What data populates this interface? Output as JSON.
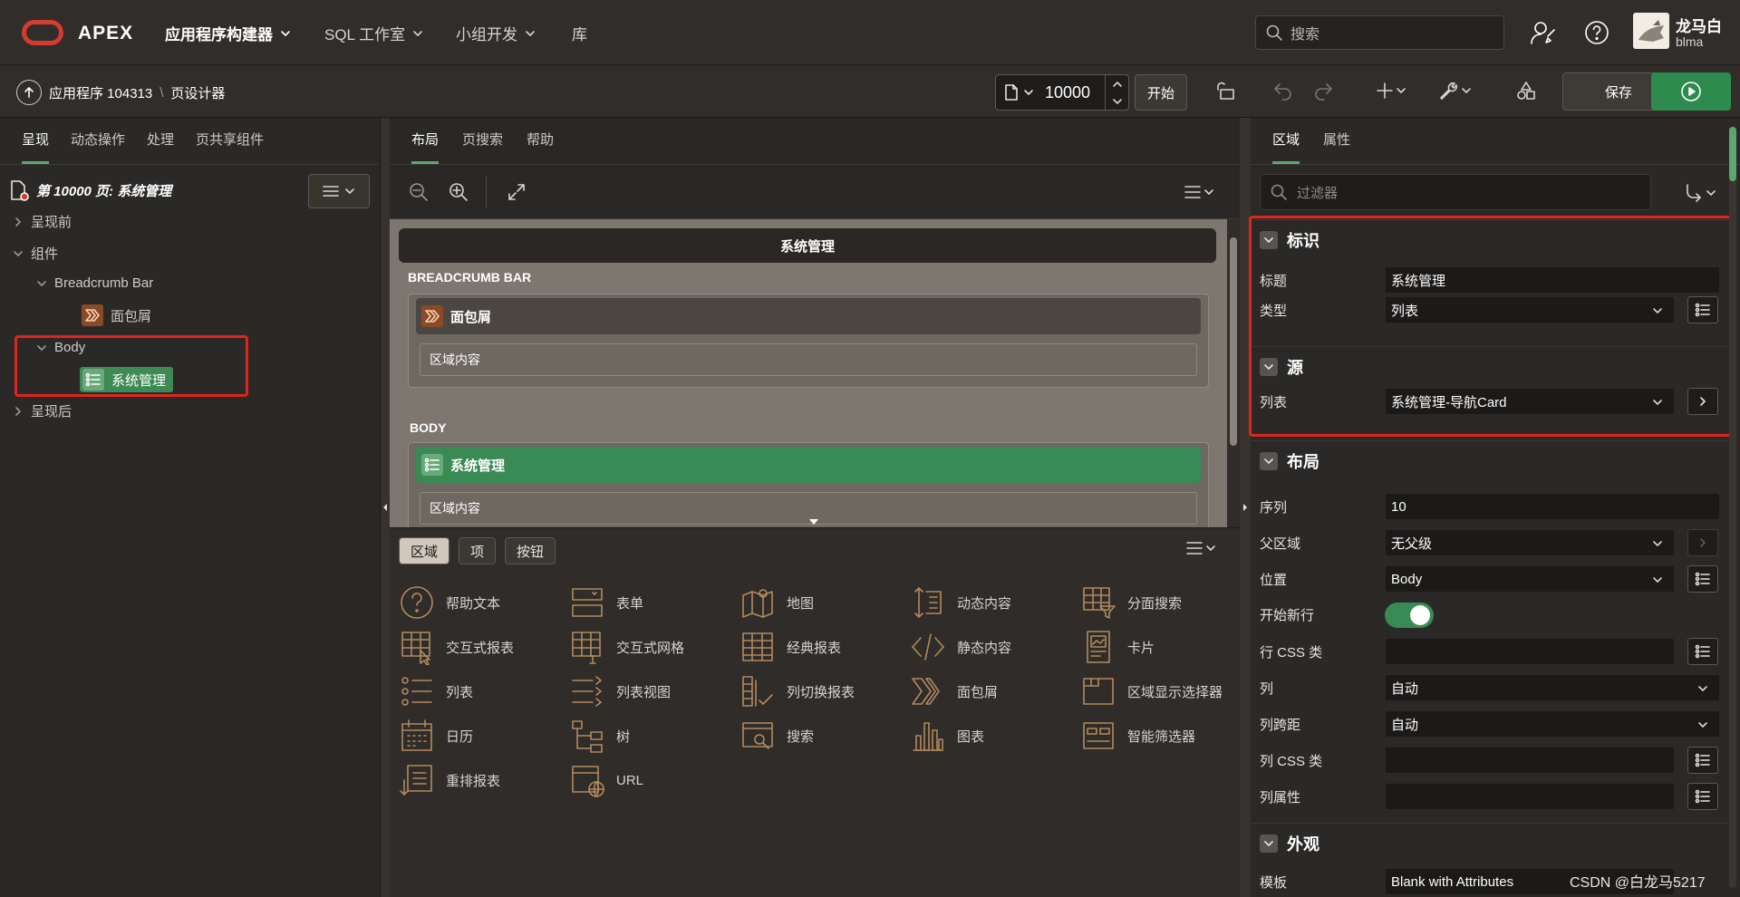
{
  "topbar": {
    "logo_text": "APEX",
    "nav": [
      "应用程序构建器",
      "SQL 工作室",
      "小组开发",
      "库"
    ],
    "search_placeholder": "搜索",
    "user_name": "龙马白",
    "user_id": "blma"
  },
  "toolbar": {
    "breadcrumb_app": "应用程序 104313",
    "breadcrumb_sep": "\\",
    "breadcrumb_page": "页设计器",
    "page_number": "10000",
    "go_label": "开始",
    "save_label": "保存"
  },
  "left": {
    "tabs": [
      "呈现",
      "动态操作",
      "处理",
      "页共享组件"
    ],
    "page_title": "第 10000 页: 系统管理",
    "tree": {
      "before": "呈现前",
      "components": "组件",
      "breadcrumb_bar": "Breadcrumb Bar",
      "breadcrumb_item": "面包屑",
      "body": "Body",
      "body_item": "系统管理",
      "after": "呈现后"
    }
  },
  "center": {
    "tabs": [
      "布局",
      "页搜索",
      "帮助"
    ],
    "canvas": {
      "page_title": "系统管理",
      "slot1": "BREADCRUMB BAR",
      "region1_title": "面包屑",
      "region1_body": "区域内容",
      "slot2": "BODY",
      "region2_title": "系统管理",
      "region2_body": "区域内容"
    },
    "gallery_tabs": [
      "区域",
      "项",
      "按钮"
    ],
    "gallery_items": [
      [
        "帮助文本",
        "表单",
        "地图",
        "动态内容",
        "分面搜索"
      ],
      [
        "交互式报表",
        "交互式网格",
        "经典报表",
        "静态内容",
        "卡片"
      ],
      [
        "列表",
        "列表视图",
        "列切换报表",
        "面包屑",
        "区域显示选择器"
      ],
      [
        "日历",
        "树",
        "搜索",
        "图表",
        "智能筛选器"
      ],
      [
        "重排报表",
        "URL"
      ]
    ]
  },
  "right": {
    "tabs": [
      "区域",
      "属性"
    ],
    "filter_placeholder": "过滤器",
    "sections": {
      "identity": "标识",
      "source": "源",
      "layout": "布局",
      "appearance": "外观"
    },
    "props": {
      "title_label": "标题",
      "title_value": "系统管理",
      "type_label": "类型",
      "type_value": "列表",
      "list_label": "列表",
      "list_value": "系统管理-导航Card",
      "seq_label": "序列",
      "seq_value": "10",
      "parent_label": "父区域",
      "parent_value": "无父级",
      "pos_label": "位置",
      "pos_value": "Body",
      "newrow_label": "开始新行",
      "rowcss_label": "行 CSS 类",
      "col_label": "列",
      "col_value": "自动",
      "colspan_label": "列跨距",
      "colspan_value": "自动",
      "colcss_label": "列 CSS 类",
      "colattr_label": "列属性",
      "template_label": "模板",
      "template_value": "Blank with Attributes"
    }
  },
  "watermark": "CSDN @白龙马5217",
  "colors": {
    "accent_green": "#3a8a56",
    "highlight_red": "#e0241e",
    "logo_red": "#d43c2f"
  }
}
